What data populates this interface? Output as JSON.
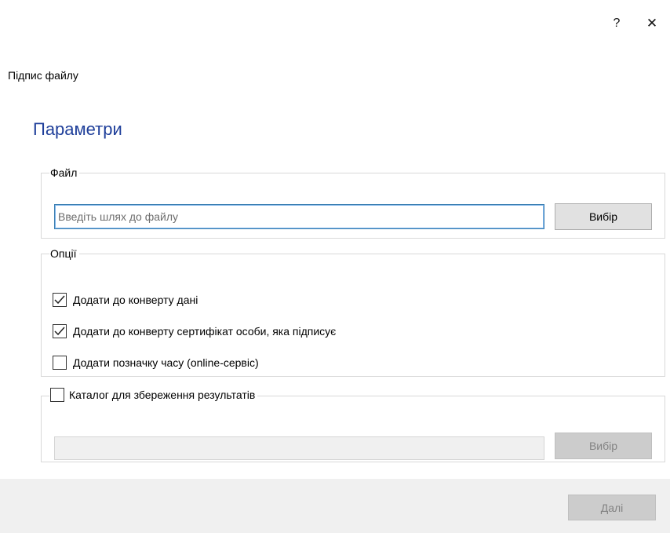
{
  "window": {
    "help_label": "?",
    "close_label": "✕",
    "title": "Підпис файлу"
  },
  "section_title": "Параметри",
  "file_group": {
    "legend": "Файл",
    "path_placeholder": "Введіть шлях до файлу",
    "browse_label": "Вибір"
  },
  "options_group": {
    "legend": "Опції",
    "options": [
      {
        "label": "Додати до конверту дані",
        "checked": true
      },
      {
        "label": "Додати до конверту сертифікат особи, яка підписує",
        "checked": true
      },
      {
        "label": "Додати позначку часу (online-сервіс)",
        "checked": false
      }
    ]
  },
  "catalog_group": {
    "legend": "Каталог для збереження результатів",
    "checked": false,
    "browse_label": "Вибір",
    "enabled": false
  },
  "footer": {
    "next_label": "Далі",
    "next_enabled": false
  },
  "icons": {
    "checkmark": "check-icon",
    "help": "help-icon",
    "close": "close-icon"
  }
}
